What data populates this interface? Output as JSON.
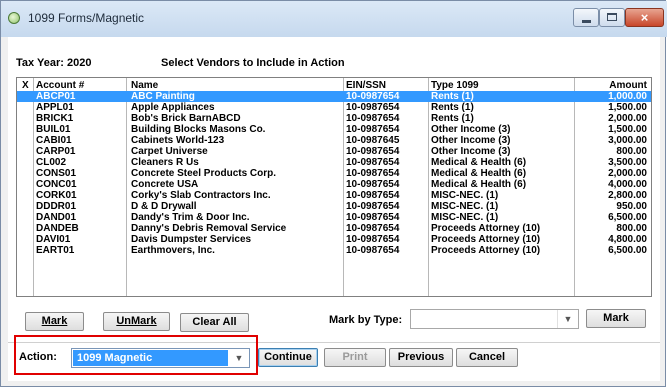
{
  "window": {
    "title": "1099 Forms/Magnetic",
    "close_glyph": "×"
  },
  "header": {
    "tax_year": "Tax Year: 2020",
    "select_title": "Select Vendors to Include in Action"
  },
  "table": {
    "columns": [
      "X",
      "Account #",
      "Name",
      "EIN/SSN",
      "Type 1099",
      "Amount"
    ],
    "rows": [
      {
        "x": "",
        "account": "ABCP01",
        "name": "ABC Painting",
        "ein": "10-0987654",
        "type": "Rents (1)",
        "amount": "1,000.00",
        "selected": true
      },
      {
        "x": "",
        "account": "APPL01",
        "name": "Apple Appliances",
        "ein": "10-0987654",
        "type": "Rents (1)",
        "amount": "1,500.00"
      },
      {
        "x": "",
        "account": "BRICK1",
        "name": "Bob's Brick BarnABCD",
        "ein": "10-0987654",
        "type": "Rents (1)",
        "amount": "2,000.00"
      },
      {
        "x": "",
        "account": "BUIL01",
        "name": "Building Blocks Masons Co.",
        "ein": "10-0987654",
        "type": "Other Income (3)",
        "amount": "1,500.00"
      },
      {
        "x": "",
        "account": "CABI01",
        "name": "Cabinets World-123",
        "ein": "10-0987645",
        "type": "Other Income (3)",
        "amount": "3,000.00"
      },
      {
        "x": "",
        "account": "CARP01",
        "name": "Carpet Universe",
        "ein": "10-0987654",
        "type": "Other Income (3)",
        "amount": "800.00"
      },
      {
        "x": "",
        "account": "CL002",
        "name": "Cleaners R Us",
        "ein": "10-0987654",
        "type": "Medical & Health (6)",
        "amount": "3,500.00"
      },
      {
        "x": "",
        "account": "CONS01",
        "name": "Concrete Steel Products Corp.",
        "ein": "10-0987654",
        "type": "Medical & Health (6)",
        "amount": "2,000.00"
      },
      {
        "x": "",
        "account": "CONC01",
        "name": "Concrete USA",
        "ein": "10-0987654",
        "type": "Medical & Health (6)",
        "amount": "4,000.00"
      },
      {
        "x": "",
        "account": "CORK01",
        "name": "Corky's Slab Contractors Inc.",
        "ein": "10-0987654",
        "type": "MISC-NEC. (1)",
        "amount": "2,800.00"
      },
      {
        "x": "",
        "account": "DDDR01",
        "name": "D & D Drywall",
        "ein": "10-0987654",
        "type": "MISC-NEC. (1)",
        "amount": "950.00"
      },
      {
        "x": "",
        "account": "DAND01",
        "name": "Dandy's Trim & Door Inc.",
        "ein": "10-0987654",
        "type": "MISC-NEC. (1)",
        "amount": "6,500.00"
      },
      {
        "x": "",
        "account": "DANDEB",
        "name": "Danny's Debris Removal Service",
        "ein": "10-0987654",
        "type": "Proceeds Attorney (10)",
        "amount": "800.00"
      },
      {
        "x": "",
        "account": "DAVI01",
        "name": "Davis Dumpster Services",
        "ein": "10-0987654",
        "type": "Proceeds Attorney (10)",
        "amount": "4,800.00"
      },
      {
        "x": "",
        "account": "EART01",
        "name": "Earthmovers, Inc.",
        "ein": "10-0987654",
        "type": "Proceeds Attorney (10)",
        "amount": "6,500.00"
      }
    ]
  },
  "buttons": {
    "mark": "Mark",
    "unmark": "UnMark",
    "clear_all": "Clear All",
    "mark_right": "Mark",
    "continue": "Continue",
    "print": "Print",
    "previous": "Previous",
    "cancel": "Cancel"
  },
  "mark_by_type": {
    "label": "Mark by Type:",
    "value": ""
  },
  "action": {
    "label": "Action:",
    "value": "1099 Magnetic"
  },
  "icons": {
    "dropdown": "chevron-down-icon",
    "app": "app-icon"
  },
  "colors": {
    "selection": "#3399ff",
    "highlight": "#e00000"
  }
}
